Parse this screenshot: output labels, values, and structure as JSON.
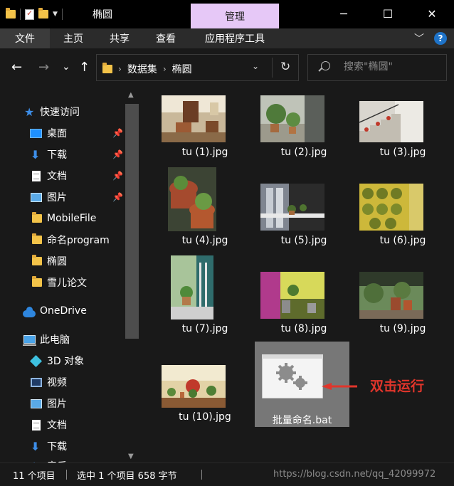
{
  "window": {
    "title": "椭圆",
    "manage_tab": "管理",
    "minimize": "─",
    "maximize": "☐",
    "close": "✕"
  },
  "ribbon": {
    "tabs": [
      "文件",
      "主页",
      "共享",
      "查看",
      "应用程序工具"
    ],
    "collapse_icon": "﹀",
    "help": "?"
  },
  "navigation": {
    "back": "←",
    "forward": "→",
    "recent": "⌄",
    "up": "↑",
    "breadcrumbs": [
      "数据集",
      "椭圆"
    ],
    "refresh": "↻",
    "search_placeholder": "搜索\"椭圆\""
  },
  "sidebar": {
    "items": [
      {
        "label": "快速访问",
        "icon": "star-icon"
      },
      {
        "label": "桌面",
        "icon": "desktop-icon",
        "pinned": true
      },
      {
        "label": "下载",
        "icon": "download-icon",
        "pinned": true
      },
      {
        "label": "文档",
        "icon": "document-icon",
        "pinned": true
      },
      {
        "label": "图片",
        "icon": "pictures-icon",
        "pinned": true
      },
      {
        "label": "MobileFile",
        "icon": "folder-icon"
      },
      {
        "label": "命名program",
        "icon": "folder-icon"
      },
      {
        "label": "椭圆",
        "icon": "folder-icon"
      },
      {
        "label": "雪儿论文",
        "icon": "folder-icon"
      },
      {
        "label": "OneDrive",
        "icon": "cloud-icon"
      },
      {
        "label": "此电脑",
        "icon": "computer-icon"
      },
      {
        "label": "3D 对象",
        "icon": "3d-objects-icon"
      },
      {
        "label": "视频",
        "icon": "video-icon"
      },
      {
        "label": "图片",
        "icon": "pictures-icon"
      },
      {
        "label": "文档",
        "icon": "document-icon"
      },
      {
        "label": "下载",
        "icon": "download-icon"
      },
      {
        "label": "音乐",
        "icon": "music-icon"
      }
    ]
  },
  "files": [
    {
      "name": "tu (1).jpg"
    },
    {
      "name": "tu (2).jpg"
    },
    {
      "name": "tu (3).jpg"
    },
    {
      "name": "tu (4).jpg"
    },
    {
      "name": "tu (5).jpg"
    },
    {
      "name": "tu (6).jpg"
    },
    {
      "name": "tu (7).jpg"
    },
    {
      "name": "tu (8).jpg"
    },
    {
      "name": "tu (9).jpg"
    },
    {
      "name": "tu (10).jpg"
    },
    {
      "name": "批量命名.bat",
      "selected": true
    }
  ],
  "annotation": {
    "text": "双击运行",
    "color": "#e0352b"
  },
  "status": {
    "item_count": "11 个项目",
    "selection": "选中 1 个项目  658 字节",
    "watermark": "https://blog.csdn.net/qq_42099972"
  },
  "colors": {
    "background": "#191919",
    "manage_tab": "#e6c8f7",
    "selected_tile": "#777777",
    "accent": "#3d8ee8"
  }
}
